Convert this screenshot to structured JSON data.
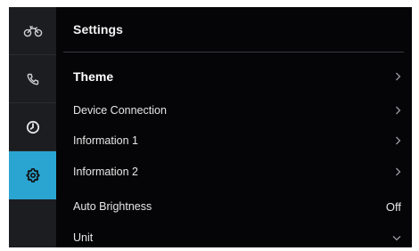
{
  "header": {
    "title": "Settings"
  },
  "sidebar": {
    "items": [
      {
        "icon": "motorcycle-icon",
        "active": false
      },
      {
        "icon": "phone-icon",
        "active": false
      },
      {
        "icon": "speedometer-icon",
        "active": false
      },
      {
        "icon": "gear-icon",
        "active": true
      }
    ],
    "accent_color": "#2aa5d1"
  },
  "settings": {
    "theme": {
      "label": "Theme",
      "indicator": "chevron-right-icon"
    },
    "device_connection": {
      "label": "Device Connection",
      "indicator": "chevron-right-icon"
    },
    "information_1": {
      "label": "Information 1",
      "indicator": "chevron-right-icon"
    },
    "information_2": {
      "label": "Information 2",
      "indicator": "chevron-right-icon"
    },
    "auto_brightness": {
      "label": "Auto Brightness",
      "value": "Off"
    },
    "unit": {
      "label": "Unit",
      "indicator": "chevron-down-icon"
    }
  }
}
